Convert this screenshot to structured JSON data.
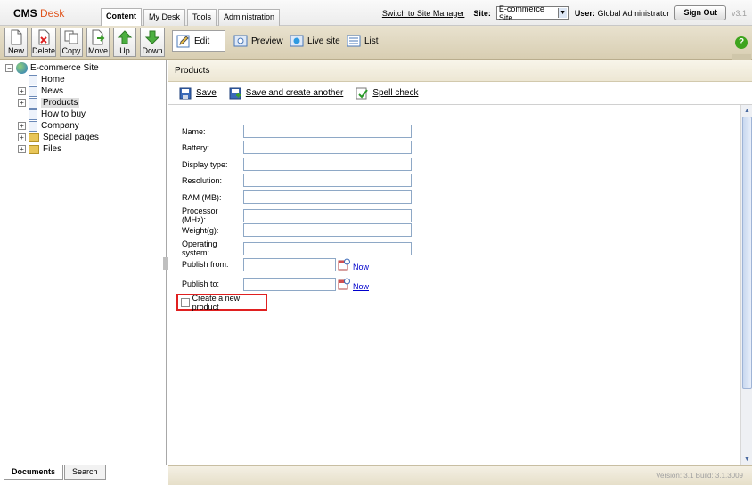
{
  "header": {
    "logo_cms": "CMS",
    "logo_desk": "Desk",
    "tabs": [
      "Content",
      "My Desk",
      "Tools",
      "Administration"
    ],
    "switch_link": "Switch to Site Manager",
    "site_label": "Site:",
    "site_value": "E-commerce Site",
    "user_label": "User:",
    "user_value": "Global Administrator",
    "sign_out": "Sign Out",
    "version": "v3.1"
  },
  "toolbar": {
    "buttons": [
      "New",
      "Delete",
      "Copy",
      "Move",
      "Up",
      "Down"
    ],
    "views": [
      "Edit",
      "Preview",
      "Live site",
      "List"
    ]
  },
  "tree": {
    "root": "E-commerce Site",
    "items": [
      "Home",
      "News",
      "Products",
      "How to buy",
      "Company",
      "Special pages",
      "Files"
    ]
  },
  "bottom_tabs": [
    "Documents",
    "Search"
  ],
  "main": {
    "title": "Products",
    "actions": [
      "Save",
      "Save and create another",
      "Spell check"
    ],
    "fields": [
      "Name:",
      "Battery:",
      "Display type:",
      "Resolution:",
      "RAM (MB):",
      "Processor (MHz):",
      "Weight(g):",
      "Operating system:"
    ],
    "publish_from": "Publish from:",
    "publish_to": "Publish to:",
    "now_label": "Now",
    "checkbox_label": "Create a new product"
  },
  "status": "Version: 3.1 Build: 3.1.3009"
}
